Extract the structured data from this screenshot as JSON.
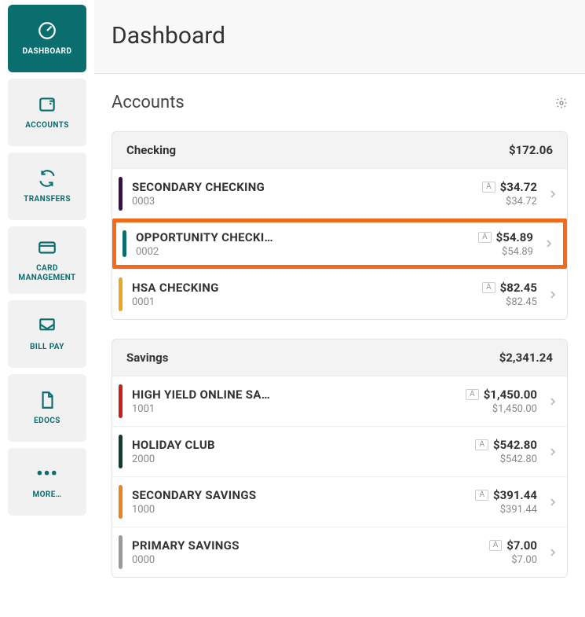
{
  "sidebar": {
    "items": [
      {
        "label": "DASHBOARD"
      },
      {
        "label": "ACCOUNTS"
      },
      {
        "label": "TRANSFERS"
      },
      {
        "label": "CARD MANAGEMENT"
      },
      {
        "label": "BILL PAY"
      },
      {
        "label": "EDOCS"
      },
      {
        "label": "MORE…"
      }
    ]
  },
  "header": {
    "title": "Dashboard"
  },
  "accounts": {
    "title": "Accounts",
    "badge": "A",
    "groups": [
      {
        "name": "Checking",
        "total": "$172.06",
        "items": [
          {
            "name": "SECONDARY CHECKING",
            "num": "0003",
            "bal1": "$34.72",
            "bal2": "$34.72",
            "color": "#3a0f49",
            "highlight": false
          },
          {
            "name": "OPPORTUNITY CHECKI…",
            "num": "0002",
            "bal1": "$54.89",
            "bal2": "$54.89",
            "color": "#0b6e6e",
            "highlight": true
          },
          {
            "name": "HSA CHECKING",
            "num": "0001",
            "bal1": "$82.45",
            "bal2": "$82.45",
            "color": "#e9a722",
            "highlight": false
          }
        ]
      },
      {
        "name": "Savings",
        "total": "$2,341.24",
        "items": [
          {
            "name": "HIGH YIELD ONLINE SA…",
            "num": "1001",
            "bal1": "$1,450.00",
            "bal2": "$1,450.00",
            "color": "#c52121",
            "highlight": false
          },
          {
            "name": "HOLIDAY CLUB",
            "num": "2000",
            "bal1": "$542.80",
            "bal2": "$542.80",
            "color": "#123d33",
            "highlight": false
          },
          {
            "name": "SECONDARY SAVINGS",
            "num": "1000",
            "bal1": "$391.44",
            "bal2": "$391.44",
            "color": "#e8851c",
            "highlight": false
          },
          {
            "name": "PRIMARY SAVINGS",
            "num": "0000",
            "bal1": "$7.00",
            "bal2": "$7.00",
            "color": "#9a9a9a",
            "highlight": false
          }
        ]
      }
    ]
  }
}
